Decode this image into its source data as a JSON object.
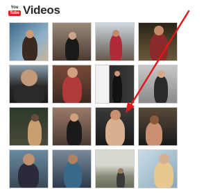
{
  "header": {
    "logo_you": "You",
    "logo_tube": "Tube",
    "title": "Videos"
  },
  "thumbnails": [
    {
      "id": "1",
      "bg": "linear-gradient(135deg,#3a6a8a,#8fb0c8 60%,#c9b49a)",
      "fig": "#3b2a22",
      "head": "#c99a7a"
    },
    {
      "id": "2",
      "bg": "linear-gradient(180deg,#9a8a7a,#4a3a32)",
      "fig": "#1a1a1a",
      "head": "#d0a48a"
    },
    {
      "id": "3",
      "bg": "linear-gradient(180deg,#cfd8de,#8a8a8a 60%,#6a5a4a)",
      "fig": "#b02a3a",
      "head": "#c08a6a"
    },
    {
      "id": "4",
      "bg": "linear-gradient(180deg,#2a2418,#6a5a3a)",
      "fig": "#8a2a2a",
      "head": "#c48a6a"
    },
    {
      "id": "5",
      "bg": "linear-gradient(180deg,#8aa0b0,#2a2a2a 55%,#1a1a1a)",
      "fig": "#2a2a2a",
      "head": "#c09a7a"
    },
    {
      "id": "6",
      "bg": "linear-gradient(180deg,#7a4a3a,#3a2a22)",
      "fig": "#b03a3a",
      "head": "#d0a080"
    },
    {
      "id": "7",
      "bg": "linear-gradient(90deg,#f2f2f2 35%,#2a2a2a 36%,#3a3a3a)",
      "fig": "#111111",
      "head": "#c89878"
    },
    {
      "id": "8",
      "bg": "linear-gradient(180deg,#c8c8c8,#8a8a8a)",
      "fig": "#2a2a2a",
      "head": "#d4a888"
    },
    {
      "id": "9",
      "bg": "linear-gradient(180deg,#2a3a2a,#4a4a3a)",
      "fig": "#c8a070",
      "head": "#6a4a3a"
    },
    {
      "id": "10",
      "bg": "linear-gradient(180deg,#9a7a6a,#4a3a32)",
      "fig": "#1a1a1a",
      "head": "#d0a07a"
    },
    {
      "id": "11",
      "bg": "linear-gradient(180deg,#3a3a3a,#1a1a1a)",
      "fig": "#d8b090",
      "head": "#c89070"
    },
    {
      "id": "12",
      "bg": "linear-gradient(180deg,#5a4a3a,#1a1a1a)",
      "fig": "#c89070",
      "head": "#8a5a3a"
    },
    {
      "id": "13",
      "bg": "linear-gradient(180deg,#6a8aa0,#3a4a5a)",
      "fig": "#2a2a3a",
      "head": "#c09070"
    },
    {
      "id": "14",
      "bg": "linear-gradient(180deg,#7a8a9a,#2a3a4a)",
      "fig": "#3a6a8a",
      "head": "#b08060"
    },
    {
      "id": "15",
      "bg": "linear-gradient(180deg,#d8d8d0 40%,#8a8a7a 70%,#6a6a5a)",
      "fig": "#3a3a3a",
      "head": "#9a7a5a"
    },
    {
      "id": "16",
      "bg": "linear-gradient(135deg,#c8dce8,#8aa8b8)",
      "fig": "#e8c890",
      "head": "#d8b090"
    }
  ]
}
